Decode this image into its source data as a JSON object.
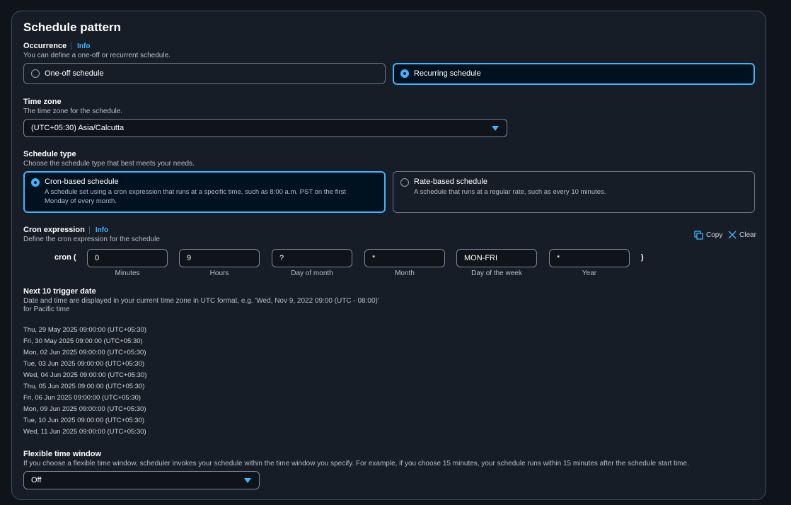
{
  "panel": {
    "title": "Schedule pattern"
  },
  "occurrence": {
    "label": "Occurrence",
    "info": "Info",
    "description": "You can define a one-off or recurrent schedule.",
    "options": [
      {
        "label": "One-off schedule",
        "selected": false
      },
      {
        "label": "Recurring schedule",
        "selected": true
      }
    ]
  },
  "timezone": {
    "label": "Time zone",
    "description": "The time zone for the schedule.",
    "value": "(UTC+05:30) Asia/Calcutta"
  },
  "schedule_type": {
    "label": "Schedule type",
    "description": "Choose the schedule type that best meets your needs.",
    "options": [
      {
        "label": "Cron-based schedule",
        "description_line1": "A schedule set using a cron expression that runs at a specific time, such as 8:00 a.m. PST on the first",
        "description_line2": "Monday of every month.",
        "selected": true
      },
      {
        "label": "Rate-based schedule",
        "description_line1": "A schedule that runs at a regular rate, such as every 10 minutes.",
        "selected": false
      }
    ]
  },
  "cron": {
    "label": "Cron expression",
    "info": "Info",
    "description": "Define the cron expression for the schedule",
    "prefix": "cron (",
    "suffix": ")",
    "copy_label": "Copy",
    "clear_label": "Clear",
    "fields": [
      {
        "value": "0",
        "caption": "Minutes"
      },
      {
        "value": "9",
        "caption": "Hours"
      },
      {
        "value": "?",
        "caption": "Day of month"
      },
      {
        "value": "*",
        "caption": "Month"
      },
      {
        "value": "MON-FRI",
        "caption": "Day of the week"
      },
      {
        "value": "*",
        "caption": "Year"
      }
    ]
  },
  "triggers": {
    "label": "Next 10 trigger date",
    "description_line1": "Date and time are displayed in your current time zone in UTC format, e.g. 'Wed, Nov 9, 2022 09:00 (UTC - 08:00)'",
    "description_line2": "for Pacific time",
    "dates": [
      "Thu, 29 May 2025 09:00:00 (UTC+05:30)",
      "Fri, 30 May 2025 09:00:00 (UTC+05:30)",
      "Mon, 02 Jun 2025 09:00:00 (UTC+05:30)",
      "Tue, 03 Jun 2025 09:00:00 (UTC+05:30)",
      "Wed, 04 Jun 2025 09:00:00 (UTC+05:30)",
      "Thu, 05 Jun 2025 09:00:00 (UTC+05:30)",
      "Fri, 06 Jun 2025 09:00:00 (UTC+05:30)",
      "Mon, 09 Jun 2025 09:00:00 (UTC+05:30)",
      "Tue, 10 Jun 2025 09:00:00 (UTC+05:30)",
      "Wed, 11 Jun 2025 09:00:00 (UTC+05:30)"
    ]
  },
  "flex_window": {
    "label": "Flexible time window",
    "description": "If you choose a flexible time window, scheduler invokes your schedule within the time window you specify. For example, if you choose 15 minutes, your schedule runs within 15 minutes after the schedule start time.",
    "value": "Off"
  },
  "colors": {
    "accent": "#42b4ff",
    "background": "#0f141a",
    "panel": "#161d26",
    "selected_bg": "#00111f"
  },
  "icons": {
    "copy": "copy-icon",
    "clear": "close-icon",
    "dropdown": "caret-down-icon"
  }
}
